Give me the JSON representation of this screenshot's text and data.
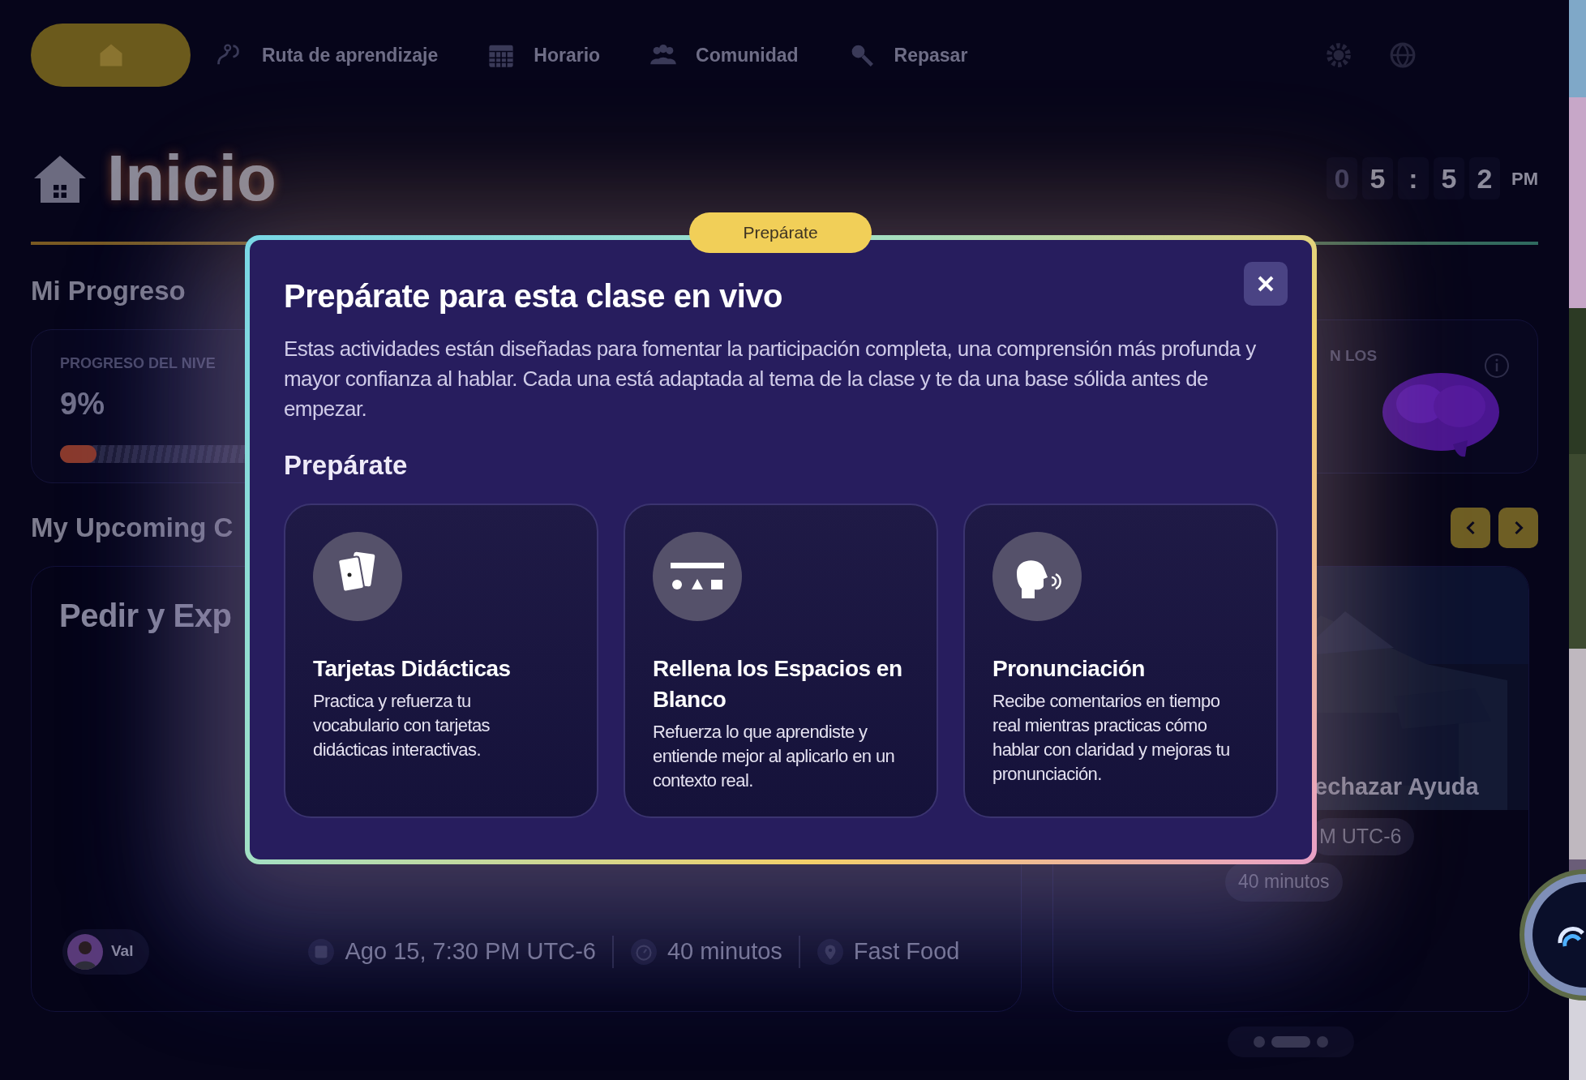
{
  "nav": {
    "items": [
      {
        "selected": true
      },
      {
        "label": "Ruta de aprendizaje",
        "selected": false
      },
      {
        "label": "Horario",
        "selected": false
      },
      {
        "label": "Comunidad",
        "selected": false
      },
      {
        "label": "Repasar",
        "selected": false
      }
    ]
  },
  "page": {
    "title": "Inicio",
    "clock": [
      {
        "text": "0",
        "dim": true
      },
      {
        "text": "5",
        "dim": false
      },
      {
        "text": ":",
        "dim": false
      },
      {
        "text": "5",
        "dim": false
      },
      {
        "text": "2",
        "dim": false
      }
    ],
    "period": "PM"
  },
  "progress": {
    "heading": "Mi Progreso",
    "label": "PROGRESO DEL NIVE",
    "value": "9%",
    "level": 0.09
  },
  "side_card": {
    "label": "N LOS"
  },
  "upcoming": {
    "heading": "My Upcoming C",
    "classes": [
      {
        "title": "Pedir y Exp",
        "teacher": "Val",
        "date": "Ago 15, 7:30 PM UTC-6",
        "duration": "40 minutos",
        "place": "Fast Food"
      },
      {
        "title": "echazar Ayuda",
        "date": "M UTC-6",
        "duration": "40 minutos"
      }
    ],
    "pages": [
      {
        "selected": false
      },
      {
        "selected": true
      },
      {
        "selected": false
      }
    ]
  },
  "modal": {
    "badge": "Prepárate",
    "title": "Prepárate para esta clase en vivo",
    "body": "Estas actividades están diseñadas para fomentar la participación completa, una comprensión más profunda y mayor confianza al hablar. Cada una está adaptada al tema de la clase y te da una base sólida antes de empezar.",
    "section": "Prepárate",
    "activities": [
      {
        "title": "Tarjetas Didácticas",
        "description": "Practica y refuerza tu vocabulario con tarjetas didácticas interactivas."
      },
      {
        "title": "Rellena los Espacios en Blanco",
        "description": "Refuerza lo que aprendiste y entiende mejor al aplicarlo en un contexto real."
      },
      {
        "title": "Pronunciación",
        "description": "Recibe comentarios en tiempo real mientras practicas cómo hablar con claridad y mejoras tu pronunciación."
      }
    ]
  }
}
